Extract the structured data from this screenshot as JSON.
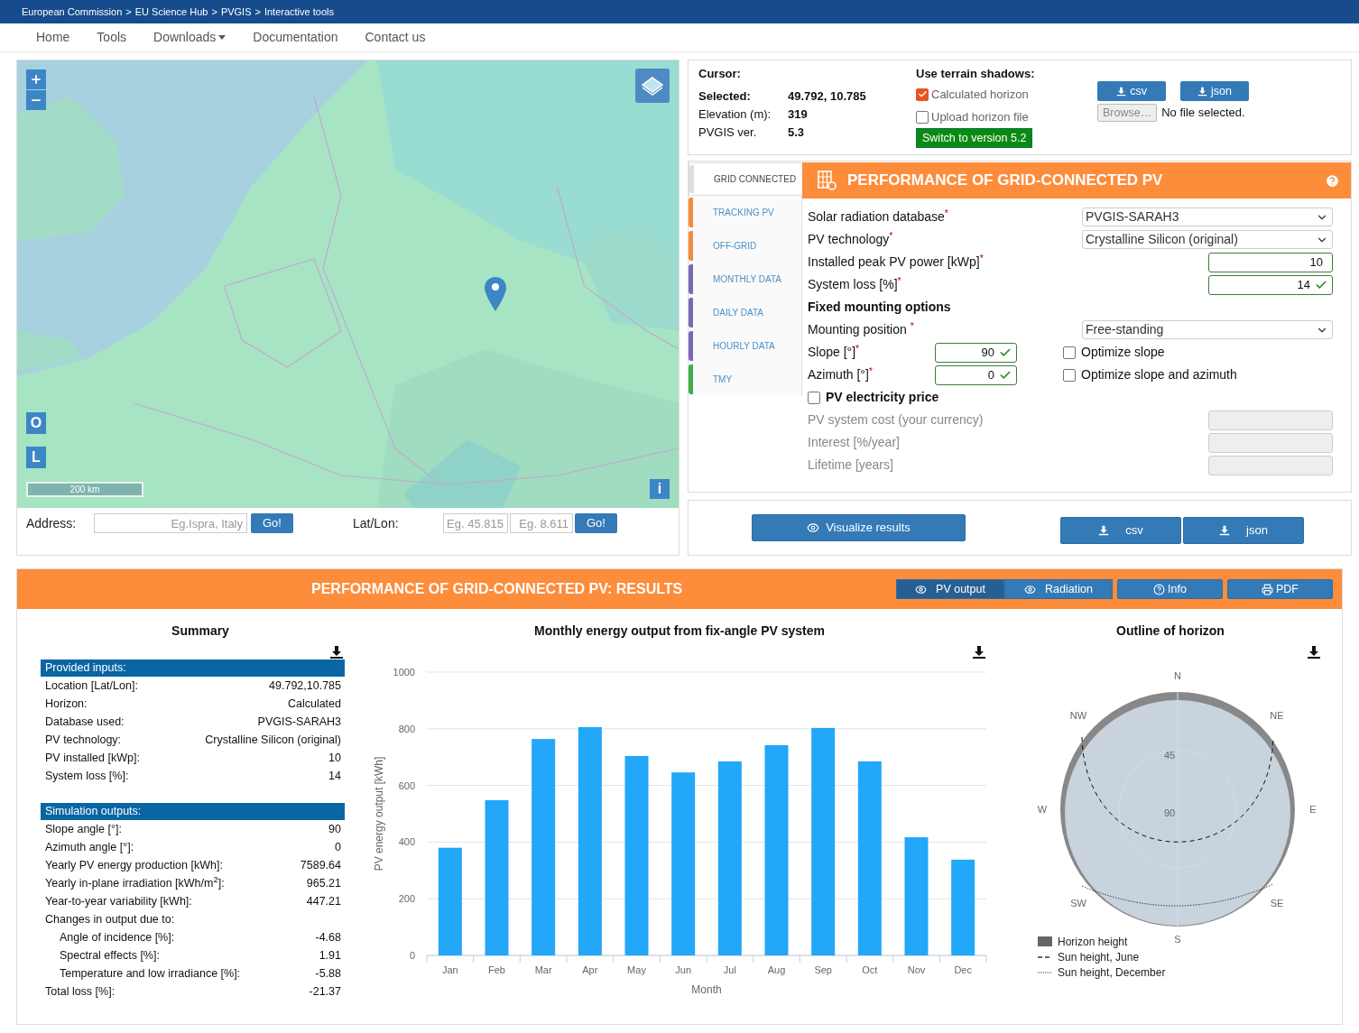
{
  "breadcrumb": [
    "European Commission",
    "EU Science Hub",
    "PVGIS",
    "Interactive tools"
  ],
  "separator": ">",
  "nav": [
    {
      "label": "Home",
      "dropdown": false
    },
    {
      "label": "Tools",
      "dropdown": false
    },
    {
      "label": "Downloads",
      "dropdown": true
    },
    {
      "label": "Documentation",
      "dropdown": false
    },
    {
      "label": "Contact us",
      "dropdown": false
    }
  ],
  "map": {
    "scale": "200 km",
    "side_buttons": [
      "O",
      "L"
    ],
    "info": "i",
    "address": {
      "label": "Address:",
      "placeholder": "Eg.Ispra, Italy",
      "button": "Go!"
    },
    "latlon": {
      "label": "Lat/Lon:",
      "lat_placeholder": "Eg. 45.815",
      "lon_placeholder": "Eg. 8.611",
      "button": "Go!"
    }
  },
  "info_panel": {
    "cursor_label": "Cursor:",
    "selected_label": "Selected:",
    "selected": "49.792, 10.785",
    "elevation_label": "Elevation (m):",
    "elevation": "319",
    "version_label": "PVGIS ver.",
    "version": "5.3",
    "shadows_title": "Use terrain shadows:",
    "options": [
      {
        "label": "Calculated horizon",
        "checked": true
      },
      {
        "label": "Upload horizon file",
        "checked": false
      }
    ],
    "switch_button": "Switch to version 5.2",
    "downloads": [
      "csv",
      "json"
    ],
    "browse": "Browse…",
    "file_status": "No file selected."
  },
  "calculator": {
    "tabs": [
      {
        "label": "GRID CONNECTED",
        "color": "#dddddd",
        "selected": true
      },
      {
        "label": "TRACKING PV",
        "color": "#f58a3a",
        "selected": false
      },
      {
        "label": "OFF-GRID",
        "color": "#f58a3a",
        "selected": false
      },
      {
        "label": "MONTHLY DATA",
        "color": "#7b68b5",
        "selected": false
      },
      {
        "label": "DAILY DATA",
        "color": "#7b68b5",
        "selected": false
      },
      {
        "label": "HOURLY DATA",
        "color": "#7b68b5",
        "selected": false
      },
      {
        "label": "TMY",
        "color": "#3bae4a",
        "selected": false
      }
    ],
    "title": "PERFORMANCE OF GRID-CONNECTED PV",
    "fields": [
      {
        "kind": "select",
        "label": "Solar radiation database$^{*}$",
        "value": "PVGIS-SARAH3"
      },
      {
        "kind": "select",
        "label": "PV technology$^{*}$",
        "value": "Crystalline Silicon (original)"
      },
      {
        "kind": "number",
        "label": "Installed peak PV power [kWp]$^{*}$",
        "value": "10",
        "validated": false
      },
      {
        "kind": "number",
        "label": "System loss [%]$^{*}$",
        "value": "14",
        "validated": true
      },
      {
        "kind": "heading",
        "label": "Fixed mounting options"
      },
      {
        "kind": "select",
        "label": "Mounting position $^{*}$",
        "value": "Free-standing"
      },
      {
        "kind": "angle",
        "label": "Slope [°]$^{*}$",
        "value": "90",
        "validated": true,
        "option": {
          "label": "Optimize slope",
          "checked": false
        }
      },
      {
        "kind": "angle",
        "label": "Azimuth [°]$^{*}$",
        "value": "0",
        "validated": true,
        "option": {
          "label": "Optimize slope and azimuth",
          "checked": false
        }
      },
      {
        "kind": "toggle",
        "label": "PV electricity price",
        "checked": false
      },
      {
        "kind": "number",
        "label": "PV system cost (your currency)",
        "disabled": true
      },
      {
        "kind": "number",
        "label": "Interest [%/year]",
        "disabled": true
      },
      {
        "kind": "number",
        "label": "Lifetime [years]",
        "disabled": true
      }
    ]
  },
  "actions": {
    "visualize": "Visualize results",
    "downloads": [
      "csv",
      "json"
    ]
  },
  "results": {
    "title": "PERFORMANCE OF GRID-CONNECTED PV: RESULTS",
    "views": [
      {
        "label": "PV output",
        "selected": true
      },
      {
        "label": "Radiation",
        "selected": false
      }
    ],
    "buttons": [
      {
        "label": "Info",
        "kind": "info"
      },
      {
        "label": "PDF",
        "kind": "pdf"
      }
    ],
    "summary": {
      "title": "Summary",
      "sections": [
        {
          "title": "Provided inputs:",
          "rows": [
            {
              "label": "Location [Lat/Lon]:",
              "value": "49.792,10.785"
            },
            {
              "label": "Horizon:",
              "value": "Calculated"
            },
            {
              "label": "Database used:",
              "value": "PVGIS-SARAH3"
            },
            {
              "label": "PV technology:",
              "value": "Crystalline Silicon (original)"
            },
            {
              "label": "PV installed [kWp]:",
              "value": "10"
            },
            {
              "label": "System loss [%]:",
              "value": "14"
            }
          ]
        },
        {
          "title": "Simulation outputs:",
          "rows": [
            {
              "label": "Slope angle [°]:",
              "value": "90"
            },
            {
              "label": "Azimuth angle [°]:",
              "value": "0"
            },
            {
              "label": "Yearly PV energy production [kWh]:",
              "value": "7589.64"
            },
            {
              "label": "Yearly in-plane irradiation [kWh/m$^{2}$]:",
              "value": "965.21"
            },
            {
              "label": "Year-to-year variability [kWh]:",
              "value": "447.21"
            },
            {
              "label": "Changes in output due to:",
              "children": [
                {
                  "label": "Angle of incidence [%]:",
                  "value": "-4.68"
                },
                {
                  "label": "Spectral effects [%]:",
                  "value": "1.91"
                },
                {
                  "label": "Temperature and low irradiance [%]:",
                  "value": "-5.88"
                }
              ]
            },
            {
              "label": "Total loss [%]:",
              "value": "-21.37"
            }
          ]
        }
      ]
    },
    "chart": {
      "title": "Monthly energy output from fix-angle PV system",
      "chart_data": {
        "type": "bar",
        "xlabel": "Month",
        "ylabel": "PV energy output [kWh]",
        "categories": [
          "Jan",
          "Feb",
          "Mar",
          "Apr",
          "May",
          "Jun",
          "Jul",
          "Aug",
          "Sep",
          "Oct",
          "Nov",
          "Dec"
        ],
        "grid": true,
        "series": [
          {
            "color": "#22a7f9",
            "values": [
              380,
              548,
              764,
              806,
              704,
              646,
              685,
              742,
              803,
              685,
              417,
              338
            ]
          }
        ],
        "ylim": [
          0,
          1000
        ],
        "yticks": [
          0,
          200,
          400,
          600,
          800,
          1000
        ]
      }
    },
    "horizon": {
      "title": "Outline of horizon",
      "directions": [
        "N",
        "NE",
        "E",
        "SE",
        "S",
        "SW",
        "W",
        "NW"
      ],
      "rings": [
        "45",
        "90"
      ],
      "legend": [
        {
          "label": "Horizon height",
          "kind": "area"
        },
        {
          "label": "Sun height, June",
          "kind": "dashed"
        },
        {
          "label": "Sun height, December",
          "kind": "dotted"
        }
      ]
    }
  }
}
